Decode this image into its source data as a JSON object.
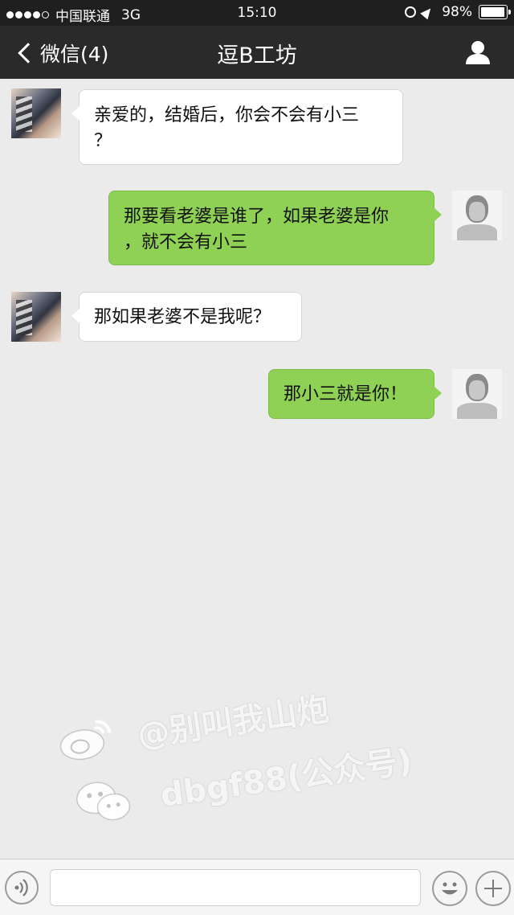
{
  "status_bar": {
    "carrier": "中国联通",
    "network": "3G",
    "time": "15:10",
    "battery": "98%",
    "battery_level": 0.98
  },
  "nav": {
    "back_label": "微信(4)",
    "title": "逗B工坊"
  },
  "messages": [
    {
      "side": "left",
      "avatar": "girl-avatar",
      "text_lines": [
        "亲爱的，结婚后，你会不会有小三",
        "？"
      ]
    },
    {
      "side": "right",
      "avatar": "man-avatar",
      "text_lines": [
        "那要看老婆是谁了，如果老婆是你",
        "，就不会有小三"
      ]
    },
    {
      "side": "left",
      "avatar": "girl-avatar",
      "text_lines": [
        "那如果老婆不是我呢？"
      ]
    },
    {
      "side": "right",
      "avatar": "man-avatar",
      "text_lines": [
        "那小三就是你！"
      ]
    }
  ],
  "watermark": {
    "weibo": "@别叫我山炮",
    "wechat": "dbgf88(公众号)"
  },
  "input_bar": {
    "value": "",
    "placeholder": ""
  },
  "colors": {
    "background": "#ebebeb",
    "nav_bar": "#2a2a2a",
    "sent_bubble": "#8ed154",
    "received_bubble": "#ffffff"
  }
}
